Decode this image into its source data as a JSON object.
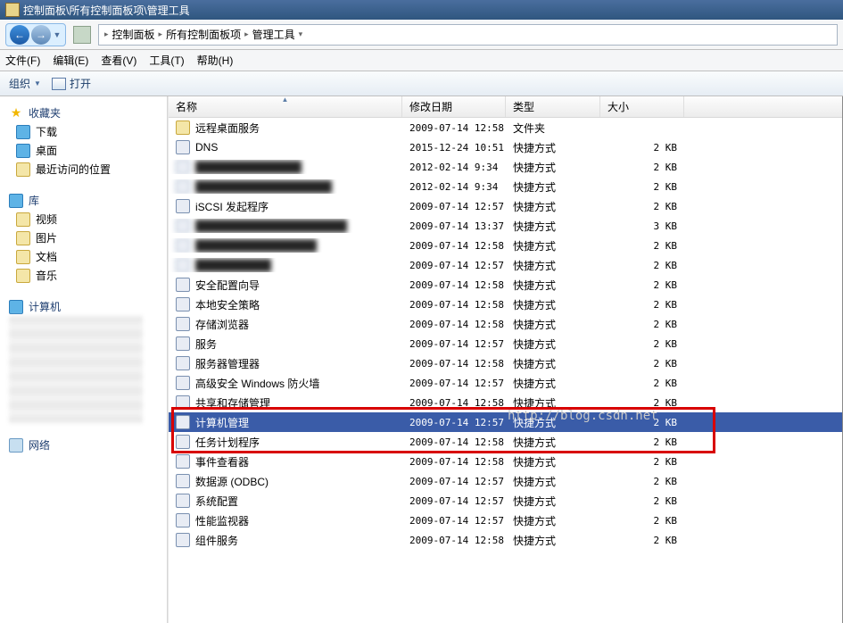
{
  "title": "控制面板\\所有控制面板项\\管理工具",
  "breadcrumb": [
    "控制面板",
    "所有控制面板项",
    "管理工具"
  ],
  "menu": {
    "file": "文件(F)",
    "edit": "编辑(E)",
    "view": "查看(V)",
    "tools": "工具(T)",
    "help": "帮助(H)"
  },
  "toolbar": {
    "organize": "组织",
    "open": "打开"
  },
  "sidebar": {
    "fav_hdr": "收藏夹",
    "fav": [
      "下载",
      "桌面",
      "最近访问的位置"
    ],
    "lib_hdr": "库",
    "lib": [
      "视频",
      "图片",
      "文档",
      "音乐"
    ],
    "computer_hdr": "计算机",
    "network_hdr": "网络"
  },
  "columns": {
    "name": "名称",
    "date": "修改日期",
    "type": "类型",
    "size": "大小"
  },
  "rows": [
    {
      "name": "远程桌面服务",
      "date": "2009-07-14 12:58",
      "type": "文件夹",
      "size": "",
      "icon": "folder",
      "blur": false
    },
    {
      "name": "DNS",
      "date": "2015-12-24 10:51",
      "type": "快捷方式",
      "size": "2 KB",
      "icon": "app",
      "blur": false
    },
    {
      "name": "██████████████",
      "date": "2012-02-14 9:34",
      "type": "快捷方式",
      "size": "2 KB",
      "icon": "app",
      "blur": true
    },
    {
      "name": "██████████████████",
      "date": "2012-02-14 9:34",
      "type": "快捷方式",
      "size": "2 KB",
      "icon": "app",
      "blur": true
    },
    {
      "name": "iSCSI 发起程序",
      "date": "2009-07-14 12:57",
      "type": "快捷方式",
      "size": "2 KB",
      "icon": "app",
      "blur": false
    },
    {
      "name": "████████████████████",
      "date": "2009-07-14 13:37",
      "type": "快捷方式",
      "size": "3 KB",
      "icon": "app",
      "blur": true
    },
    {
      "name": "████████████████",
      "date": "2009-07-14 12:58",
      "type": "快捷方式",
      "size": "2 KB",
      "icon": "app",
      "blur": true
    },
    {
      "name": "██████████",
      "date": "2009-07-14 12:57",
      "type": "快捷方式",
      "size": "2 KB",
      "icon": "app",
      "blur": true
    },
    {
      "name": "安全配置向导",
      "date": "2009-07-14 12:58",
      "type": "快捷方式",
      "size": "2 KB",
      "icon": "app",
      "blur": false
    },
    {
      "name": "本地安全策略",
      "date": "2009-07-14 12:58",
      "type": "快捷方式",
      "size": "2 KB",
      "icon": "app",
      "blur": false
    },
    {
      "name": "存储浏览器",
      "date": "2009-07-14 12:58",
      "type": "快捷方式",
      "size": "2 KB",
      "icon": "app",
      "blur": false
    },
    {
      "name": "服务",
      "date": "2009-07-14 12:57",
      "type": "快捷方式",
      "size": "2 KB",
      "icon": "app",
      "blur": false
    },
    {
      "name": "服务器管理器",
      "date": "2009-07-14 12:58",
      "type": "快捷方式",
      "size": "2 KB",
      "icon": "app",
      "blur": false
    },
    {
      "name": "高级安全 Windows 防火墙",
      "date": "2009-07-14 12:57",
      "type": "快捷方式",
      "size": "2 KB",
      "icon": "app",
      "blur": false
    },
    {
      "name": "共享和存储管理",
      "date": "2009-07-14 12:58",
      "type": "快捷方式",
      "size": "2 KB",
      "icon": "app",
      "blur": false
    },
    {
      "name": "计算机管理",
      "date": "2009-07-14 12:57",
      "type": "快捷方式",
      "size": "2 KB",
      "icon": "app",
      "blur": false,
      "selected": true
    },
    {
      "name": "任务计划程序",
      "date": "2009-07-14 12:58",
      "type": "快捷方式",
      "size": "2 KB",
      "icon": "app",
      "blur": false
    },
    {
      "name": "事件查看器",
      "date": "2009-07-14 12:58",
      "type": "快捷方式",
      "size": "2 KB",
      "icon": "app",
      "blur": false
    },
    {
      "name": "数据源 (ODBC)",
      "date": "2009-07-14 12:57",
      "type": "快捷方式",
      "size": "2 KB",
      "icon": "app",
      "blur": false
    },
    {
      "name": "系统配置",
      "date": "2009-07-14 12:57",
      "type": "快捷方式",
      "size": "2 KB",
      "icon": "app",
      "blur": false
    },
    {
      "name": "性能监视器",
      "date": "2009-07-14 12:57",
      "type": "快捷方式",
      "size": "2 KB",
      "icon": "app",
      "blur": false
    },
    {
      "name": "组件服务",
      "date": "2009-07-14 12:58",
      "type": "快捷方式",
      "size": "2 KB",
      "icon": "app",
      "blur": false
    }
  ],
  "watermark": "http://blog.csdn.net"
}
